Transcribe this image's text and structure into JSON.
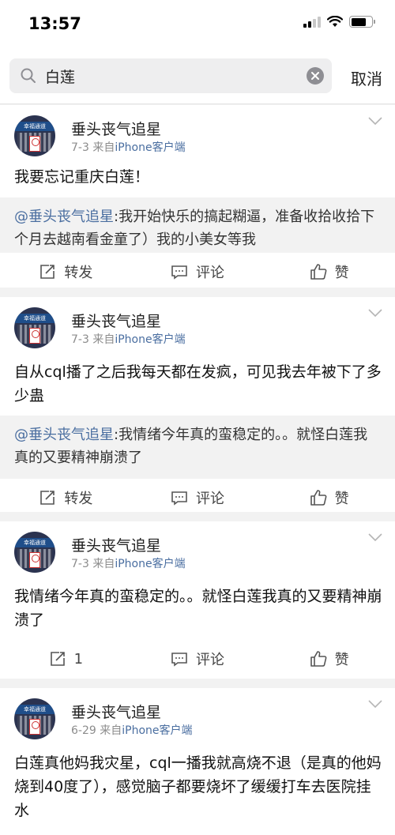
{
  "status_bar": {
    "time": "13:57"
  },
  "search": {
    "query": "白莲",
    "cancel_label": "取消"
  },
  "posts": [
    {
      "username": "垂头丧气追星",
      "date": "7-3",
      "source_prefix": "来自",
      "source": "iPhone客户端",
      "avatar_text": "幸福通道",
      "text": "我要忘记重庆白莲！",
      "repost_mention": "@垂头丧气追星",
      "repost_text": ":我开始快乐的搞起糊逼，准备收拾收拾下个月去越南看金童了）我的小美女等我",
      "actions": {
        "repost": "转发",
        "comment": "评论",
        "like": "赞"
      }
    },
    {
      "username": "垂头丧气追星",
      "date": "7-3",
      "source_prefix": "来自",
      "source": "iPhone客户端",
      "avatar_text": "幸福通道",
      "text": "自从cql播了之后我每天都在发疯，可见我去年被下了多少蛊",
      "repost_mention": "@垂头丧气追星",
      "repost_text": ":我情绪今年真的蛮稳定的。。就怪白莲我真的又要精神崩溃了",
      "actions": {
        "repost": "转发",
        "comment": "评论",
        "like": "赞"
      }
    },
    {
      "username": "垂头丧气追星",
      "date": "7-3",
      "source_prefix": "来自",
      "source": "iPhone客户端",
      "avatar_text": "幸福通道",
      "text": "我情绪今年真的蛮稳定的。。就怪白莲我真的又要精神崩溃了",
      "actions": {
        "repost": "1",
        "comment": "评论",
        "like": "赞"
      }
    },
    {
      "username": "垂头丧气追星",
      "date": "6-29",
      "source_prefix": "来自",
      "source": "iPhone客户端",
      "avatar_text": "幸福通道",
      "text": "白莲真他妈我灾星，cql一播我就高烧不退（是真的他妈烧到40度了），感觉脑子都要烧坏了缓缓打车去医院挂水"
    }
  ]
}
